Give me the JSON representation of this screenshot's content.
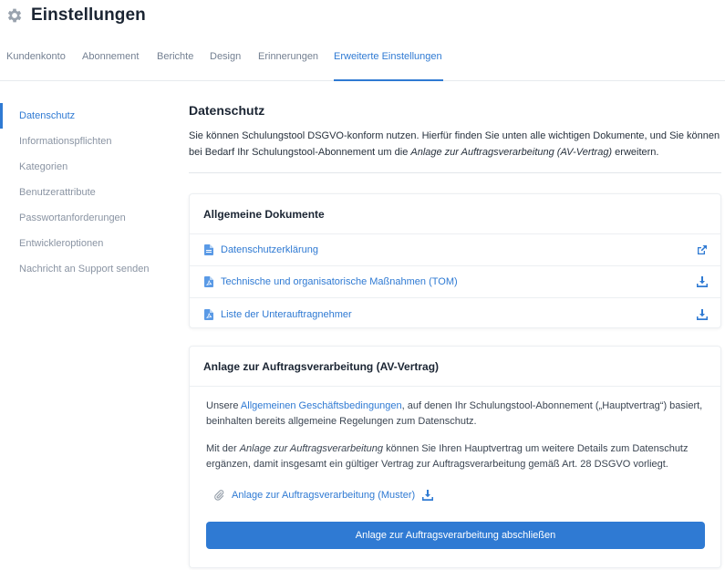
{
  "header": {
    "title": "Einstellungen",
    "icon": "gear-icon"
  },
  "tabs": [
    {
      "label": "Kundenkonto"
    },
    {
      "label": "Abonnement"
    },
    {
      "label": "Berichte"
    },
    {
      "label": "Design"
    },
    {
      "label": "Erinnerungen"
    },
    {
      "label": "Erweiterte Einstellungen",
      "active": true
    }
  ],
  "sidebar": {
    "items": [
      {
        "label": "Datenschutz",
        "active": true
      },
      {
        "label": "Informationspflichten"
      },
      {
        "label": "Kategorien"
      },
      {
        "label": "Benutzerattribute"
      },
      {
        "label": "Passwortanforderungen"
      },
      {
        "label": "Entwickleroptionen"
      },
      {
        "label": "Nachricht an Support senden"
      }
    ]
  },
  "main": {
    "title": "Datenschutz",
    "intro_before": "Sie können Schulungstool DSGVO-konform nutzen. Hierfür finden Sie unten alle wichtigen Dokumente, und Sie können bei Bedarf Ihr Schulungstool-Abonnement um die ",
    "intro_italic": "Anlage zur Auftragsverarbeitung (AV-Vertrag)",
    "intro_after": " erweitern."
  },
  "documents": {
    "title": "Allgemeine Dokumente",
    "items": [
      {
        "label": "Datenschutzerklärung",
        "action_icon": "external-link-icon"
      },
      {
        "label": "Technische und organisatorische Maßnahmen (TOM)",
        "action_icon": "download-icon"
      },
      {
        "label": "Liste der Unterauftragnehmer",
        "action_icon": "download-icon"
      }
    ]
  },
  "av": {
    "title": "Anlage zur Auftragsverarbeitung (AV-Vertrag)",
    "p1_before": "Unsere ",
    "p1_link": "Allgemeinen Geschäftsbedingungen",
    "p1_after": ", auf denen Ihr Schulungstool-Abonnement („Hauptvertrag“) basiert, beinhalten bereits allgemeine Regelungen zum Datenschutz.",
    "p2_before": "Mit der ",
    "p2_italic": "Anlage zur Auftragsverarbeitung",
    "p2_after": " können Sie Ihren Hauptvertrag um weitere Details zum Datenschutz ergänzen, damit insgesamt ein gültiger Vertrag zur Auftragsverarbeitung gemäß Art. 28 DSGVO vorliegt.",
    "attachment_label": "Anlage zur Auftragsverarbeitung (Muster)",
    "button_label": "Anlage zur Auftragsverarbeitung abschließen"
  },
  "colors": {
    "accent": "#2f7ad3",
    "text": "#1b2533",
    "muted": "#8a94a3"
  }
}
